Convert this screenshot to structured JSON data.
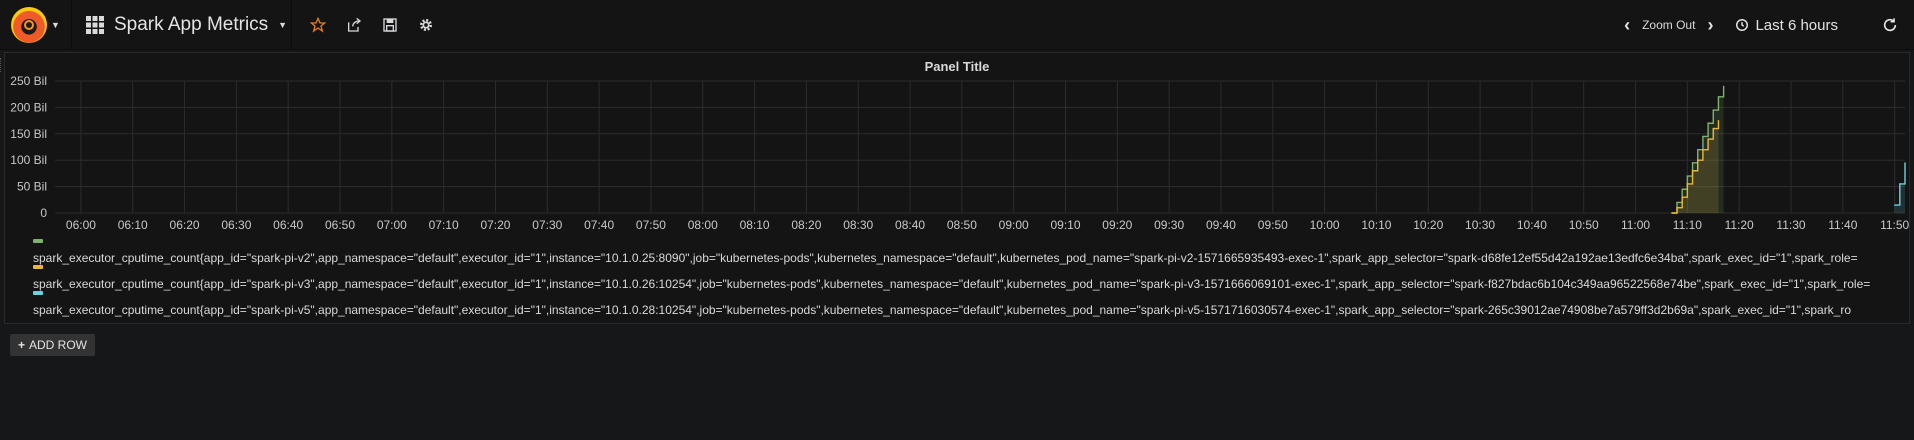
{
  "navbar": {
    "dashboard_title": "Spark App Metrics",
    "zoom_out_label": "Zoom Out",
    "time_range_label": "Last 6 hours"
  },
  "panel": {
    "title": "Panel Title"
  },
  "add_row_label": "ADD ROW",
  "colors": {
    "series_1": "#7eb26d",
    "series_2": "#eab839",
    "series_3": "#6ed0e0",
    "background": "#161719",
    "panel_bg": "#141414"
  },
  "chart_data": {
    "type": "line",
    "title": "Panel Title",
    "grid": true,
    "legend_placement": "bottom",
    "ylim": [
      0,
      250
    ],
    "y_ticks": [
      "0",
      "50 Bil",
      "100 Bil",
      "150 Bil",
      "200 Bil",
      "250 Bil"
    ],
    "y_tick_values": [
      0,
      50,
      100,
      150,
      200,
      250
    ],
    "x_ticks": [
      "06:00",
      "06:10",
      "06:20",
      "06:30",
      "06:40",
      "06:50",
      "07:00",
      "07:10",
      "07:20",
      "07:30",
      "07:40",
      "07:50",
      "08:00",
      "08:10",
      "08:20",
      "08:30",
      "08:40",
      "08:50",
      "09:00",
      "09:10",
      "09:20",
      "09:30",
      "09:40",
      "09:50",
      "10:00",
      "10:10",
      "10:20",
      "10:30",
      "10:40",
      "10:50",
      "11:00",
      "11:10",
      "11:20",
      "11:30",
      "11:40",
      "11:50"
    ],
    "x_range": [
      "05:55",
      "11:52"
    ],
    "series": [
      {
        "name": "spark_executor_cputime_count{app_id=\"spark-pi-v2\",app_namespace=\"default\",executor_id=\"1\",instance=\"10.1.0.25:8090\",job=\"kubernetes-pods\",kubernetes_namespace=\"default\",kubernetes_pod_name=\"spark-pi-v2-1571665935493-exec-1\",spark_app_selector=\"spark-d68fe12ef55d42a192ae13edfc6e34ba\",spark_exec_id=\"1\",spark_role=",
        "color": "#7eb26d",
        "x": [
          "11:07",
          "11:08",
          "11:09",
          "11:10",
          "11:11",
          "11:12",
          "11:13",
          "11:14",
          "11:15",
          "11:16",
          "11:17"
        ],
        "y": [
          0,
          20,
          45,
          70,
          95,
          120,
          145,
          170,
          195,
          220,
          240
        ]
      },
      {
        "name": "spark_executor_cputime_count{app_id=\"spark-pi-v3\",app_namespace=\"default\",executor_id=\"1\",instance=\"10.1.0.26:10254\",job=\"kubernetes-pods\",kubernetes_namespace=\"default\",kubernetes_pod_name=\"spark-pi-v3-1571666069101-exec-1\",spark_app_selector=\"spark-f827bdac6b104c349aa96522568e74be\",spark_exec_id=\"1\",spark_role=",
        "color": "#eab839",
        "x": [
          "11:07",
          "11:08",
          "11:09",
          "11:10",
          "11:11",
          "11:12",
          "11:13",
          "11:14",
          "11:15",
          "11:16"
        ],
        "y": [
          0,
          10,
          30,
          55,
          80,
          100,
          120,
          140,
          160,
          175
        ]
      },
      {
        "name": "spark_executor_cputime_count{app_id=\"spark-pi-v5\",app_namespace=\"default\",executor_id=\"1\",instance=\"10.1.0.28:10254\",job=\"kubernetes-pods\",kubernetes_namespace=\"default\",kubernetes_pod_name=\"spark-pi-v5-1571716030574-exec-1\",spark_app_selector=\"spark-265c39012ae74908be7a579ff3d2b69a\",spark_exec_id=\"1\",spark_ro",
        "color": "#6ed0e0",
        "x": [
          "11:50",
          "11:51",
          "11:52"
        ],
        "y": [
          15,
          55,
          95
        ]
      }
    ]
  }
}
